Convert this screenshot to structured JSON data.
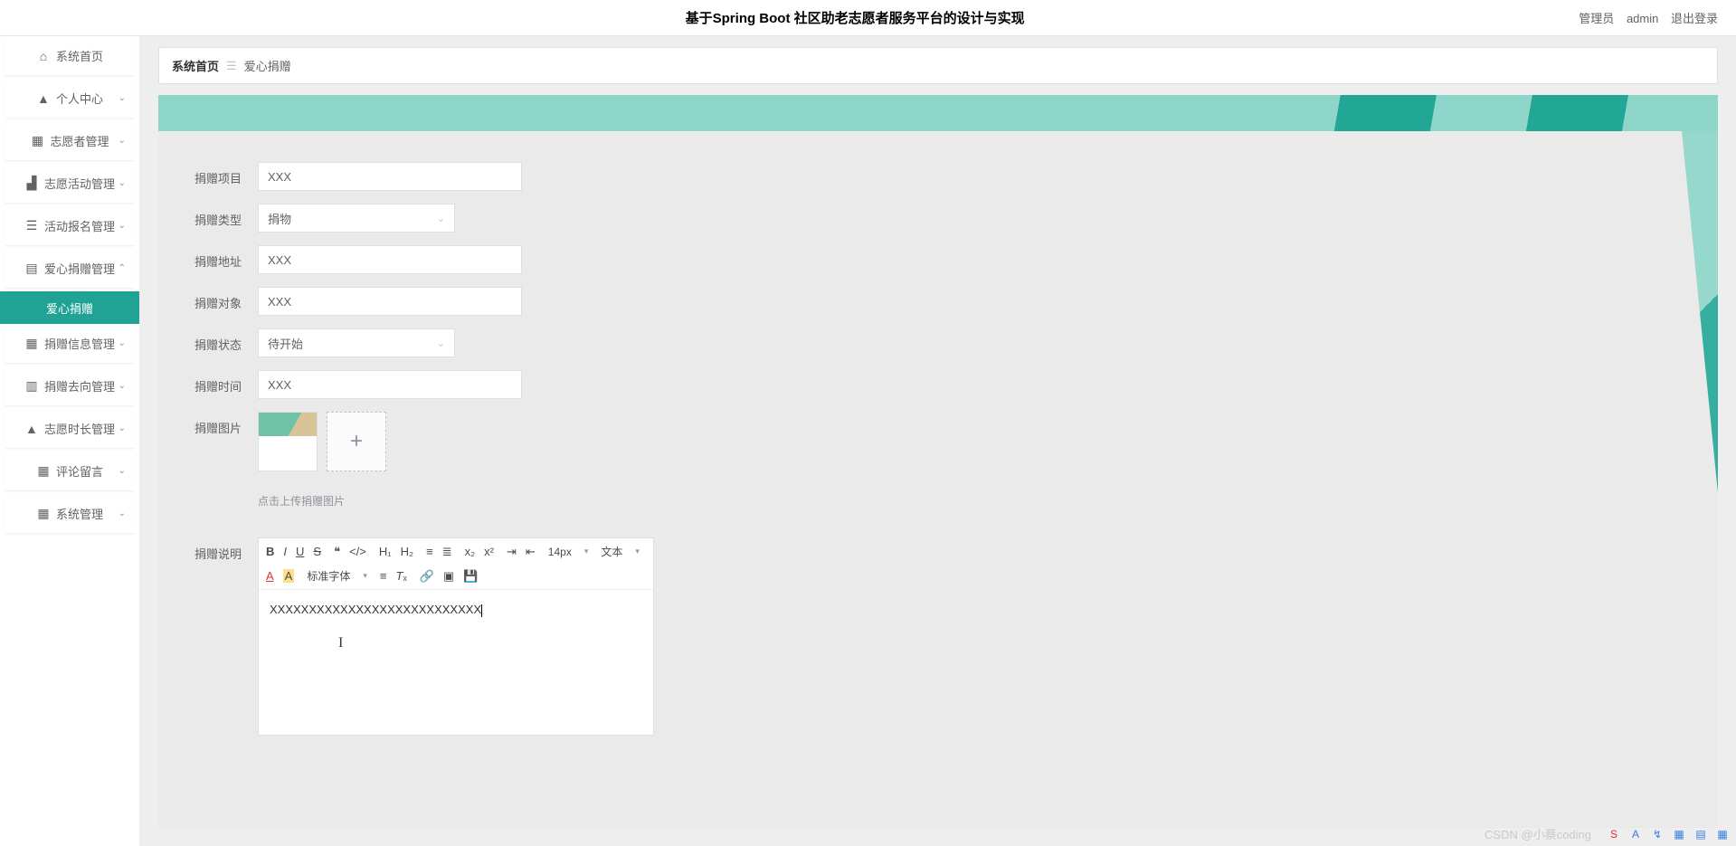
{
  "header": {
    "title": "基于Spring Boot 社区助老志愿者服务平台的设计与实现",
    "role": "管理员",
    "user": "admin",
    "logout": "退出登录"
  },
  "sidebar": {
    "items": [
      {
        "icon": "home-icon",
        "glyph": "⌂",
        "label": "系统首页",
        "expandable": false
      },
      {
        "icon": "user-icon",
        "glyph": "👤",
        "label": "个人中心",
        "expandable": true
      },
      {
        "icon": "grid-icon",
        "glyph": "▦",
        "label": "志愿者管理",
        "expandable": true
      },
      {
        "icon": "chart-icon",
        "glyph": "📊",
        "label": "志愿活动管理",
        "expandable": true
      },
      {
        "icon": "list-icon",
        "glyph": "☰",
        "label": "活动报名管理",
        "expandable": true
      },
      {
        "icon": "doc-icon",
        "glyph": "🗎",
        "label": "爱心捐赠管理",
        "expandable": true,
        "open": true
      },
      {
        "icon": "grid-icon",
        "glyph": "▦",
        "label": "捐赠信息管理",
        "expandable": true
      },
      {
        "icon": "flow-icon",
        "glyph": "📮",
        "label": "捐赠去向管理",
        "expandable": true
      },
      {
        "icon": "clock-icon",
        "glyph": "👤",
        "label": "志愿时长管理",
        "expandable": true
      },
      {
        "icon": "comment-icon",
        "glyph": "▦",
        "label": "评论留言",
        "expandable": true
      },
      {
        "icon": "gear-icon",
        "glyph": "▦",
        "label": "系统管理",
        "expandable": true
      }
    ],
    "submenu_label": "爱心捐赠"
  },
  "breadcrumb": {
    "home": "系统首页",
    "current": "爱心捐赠"
  },
  "form": {
    "project_label": "捐赠项目",
    "project_value": "XXX",
    "type_label": "捐赠类型",
    "type_value": "捐物",
    "address_label": "捐赠地址",
    "address_value": "XXX",
    "target_label": "捐赠对象",
    "target_value": "XXX",
    "status_label": "捐赠状态",
    "status_value": "待开始",
    "time_label": "捐赠时间",
    "time_value": "XXX",
    "image_label": "捐赠图片",
    "upload_hint": "点击上传捐赠图片",
    "desc_label": "捐赠说明",
    "desc_value": "XXXXXXXXXXXXXXXXXXXXXXXXXXX"
  },
  "editor": {
    "font_size": "14px",
    "text_style": "文本",
    "font_family": "标准字体"
  },
  "watermark": "CSDN @小蔡coding"
}
